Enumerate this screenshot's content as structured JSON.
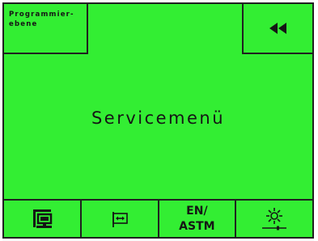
{
  "top_left_button": {
    "line1": "Programmier-",
    "line2": "ebene"
  },
  "back_button": {
    "icon": "double-left-arrow-icon"
  },
  "title": "Servicemenü",
  "bottom_bar": {
    "buttons": [
      {
        "icon": "terminal-computer-icon"
      },
      {
        "icon": "sample-flag-icon"
      },
      {
        "label_line1": "EN/",
        "label_line2": "ASTM"
      },
      {
        "icon": "brightness-sun-icon"
      }
    ]
  },
  "colors": {
    "background": "#33ee33",
    "line": "#202020"
  }
}
